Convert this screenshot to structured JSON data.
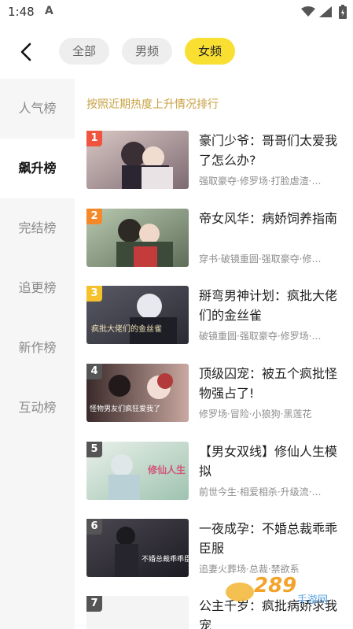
{
  "status": {
    "time": "1:48",
    "app_icon": "A"
  },
  "tabs": [
    {
      "label": "全部",
      "active": false
    },
    {
      "label": "男频",
      "active": false
    },
    {
      "label": "女频",
      "active": true
    }
  ],
  "sidebar": {
    "items": [
      {
        "label": "人气榜",
        "active": false
      },
      {
        "label": "飙升榜",
        "active": true
      },
      {
        "label": "完结榜",
        "active": false
      },
      {
        "label": "追更榜",
        "active": false
      },
      {
        "label": "新作榜",
        "active": false
      },
      {
        "label": "互动榜",
        "active": false
      }
    ]
  },
  "main": {
    "subtitle": "按照近期热度上升情况排行",
    "books": [
      {
        "rank": "1",
        "title": "豪门少爷：哥哥们太爱我了怎么办?",
        "tags": "强取豪夺·修罗场·打脸虐渣·…",
        "rank_color": "#f0543e"
      },
      {
        "rank": "2",
        "title": "帝女风华：病娇饲养指南",
        "tags": "穿书·破镜重圆·强取豪夺·修…",
        "rank_color": "#f5892a"
      },
      {
        "rank": "3",
        "title": "掰弯男神计划：疯批大佬们的金丝雀",
        "tags": "破镜重圆·强取豪夺·修罗场·…",
        "rank_color": "#f6c22b"
      },
      {
        "rank": "4",
        "title": "顶级囚宠：被五个疯批怪物强占了!",
        "tags": "修罗场·冒险·小狼狗·黑莲花",
        "rank_color": "#555555"
      },
      {
        "rank": "5",
        "title": "【男女双线】修仙人生模拟",
        "tags": "前世今生·相爱相杀·升级流·…",
        "rank_color": "#555555"
      },
      {
        "rank": "6",
        "title": "一夜成孕：不婚总裁乖乖臣服",
        "tags": "追妻火葬场·总裁·禁欲系",
        "rank_color": "#555555"
      },
      {
        "rank": "7",
        "title": "公主千岁：疯批病娇求我宠",
        "tags": "",
        "rank_color": "#555555"
      }
    ]
  },
  "covers": [
    {
      "text": ""
    },
    {
      "text": ""
    },
    {
      "text": "疯批大佬们的金丝雀"
    },
    {
      "text": "怪物男友们疯狂爱我了"
    },
    {
      "text": "修仙人生"
    },
    {
      "text": "不婚总裁乖乖臣服"
    },
    {
      "text": ""
    }
  ],
  "watermark": {
    "text": "289",
    "sub": "手游网"
  },
  "colors": {
    "accent": "#f9df32",
    "subtitle": "#c8a142",
    "sidebar_bg": "#f6f6f6"
  }
}
